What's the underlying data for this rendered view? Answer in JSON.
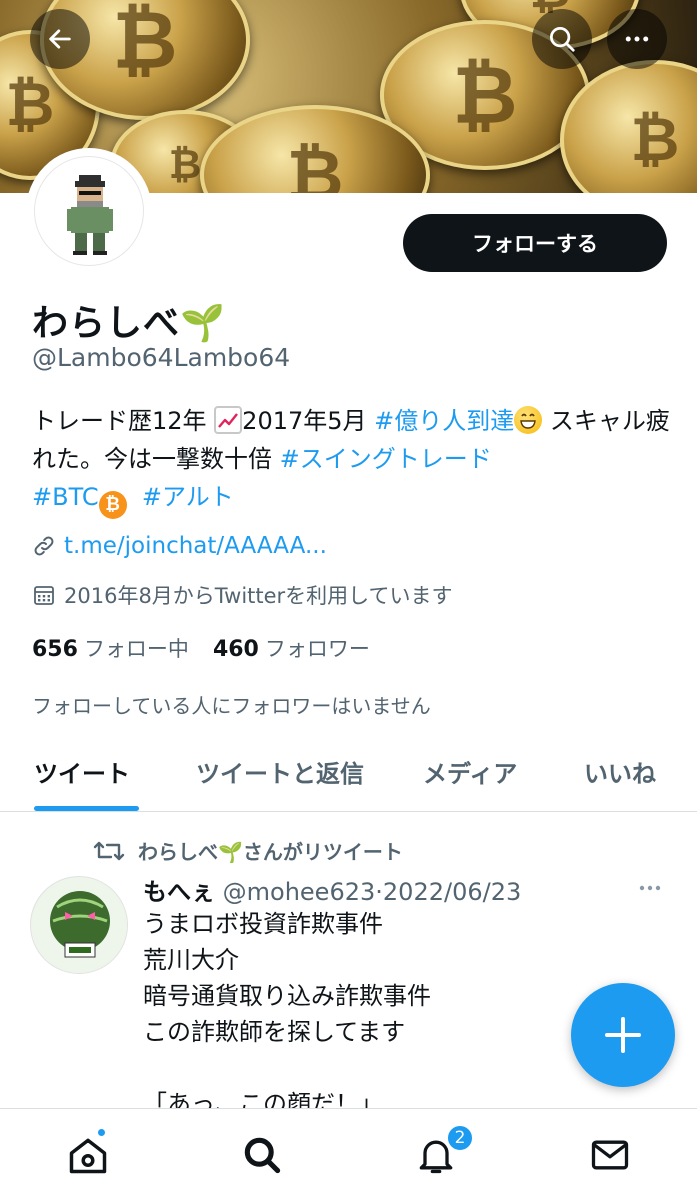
{
  "profile": {
    "display_name": "わらしべ🌱",
    "handle": "@Lambo64Lambo64",
    "follow_label": "フォローする",
    "bio_part1": "トレード歴12年 ",
    "bio_part2": "2017年5月 ",
    "bio_tag1": "#億り人到達",
    "bio_part3": " スキャル疲れた。今は一撃数十倍 ",
    "bio_tag2": "#スイングトレード",
    "bio_tag3": "#BTC",
    "bio_tag4": "#アルト",
    "link": "t.me/joinchat/AAAAA...",
    "joined": "2016年8月からTwitterを利用しています",
    "following_count": "656",
    "following_label": "フォロー中",
    "followers_count": "460",
    "followers_label": "フォロワー",
    "no_mutual": "フォローしている人にフォロワーはいません"
  },
  "tabs": [
    {
      "label": "ツイート",
      "active": true
    },
    {
      "label": "ツイートと返信",
      "active": false
    },
    {
      "label": "メディア",
      "active": false
    },
    {
      "label": "いいね",
      "active": false
    }
  ],
  "tweet": {
    "retweet_label": "わらしべ🌱さんがリツイート",
    "author_name": "もへぇ",
    "author_handle": "@mohee623",
    "separator": "·",
    "date": "2022/06/23",
    "lines": [
      "うまロボ投資詐欺事件",
      "荒川大介",
      "暗号通貨取り込み詐欺事件",
      "この詐欺師を探してます",
      "",
      "「あっ、この顔だ！」"
    ]
  },
  "nav": {
    "notifications_badge": "2"
  },
  "icons": {
    "back": "arrow-left-icon",
    "search": "search-icon",
    "more": "more-horizontal-icon",
    "link": "link-icon",
    "calendar": "calendar-icon",
    "retweet": "retweet-icon",
    "compose": "plus-icon",
    "home": "home-icon",
    "explore": "search-icon",
    "notifications": "bell-icon",
    "messages": "mail-icon"
  },
  "colors": {
    "accent": "#1d9bf0",
    "text": "#0f1419",
    "secondary": "#536471"
  }
}
